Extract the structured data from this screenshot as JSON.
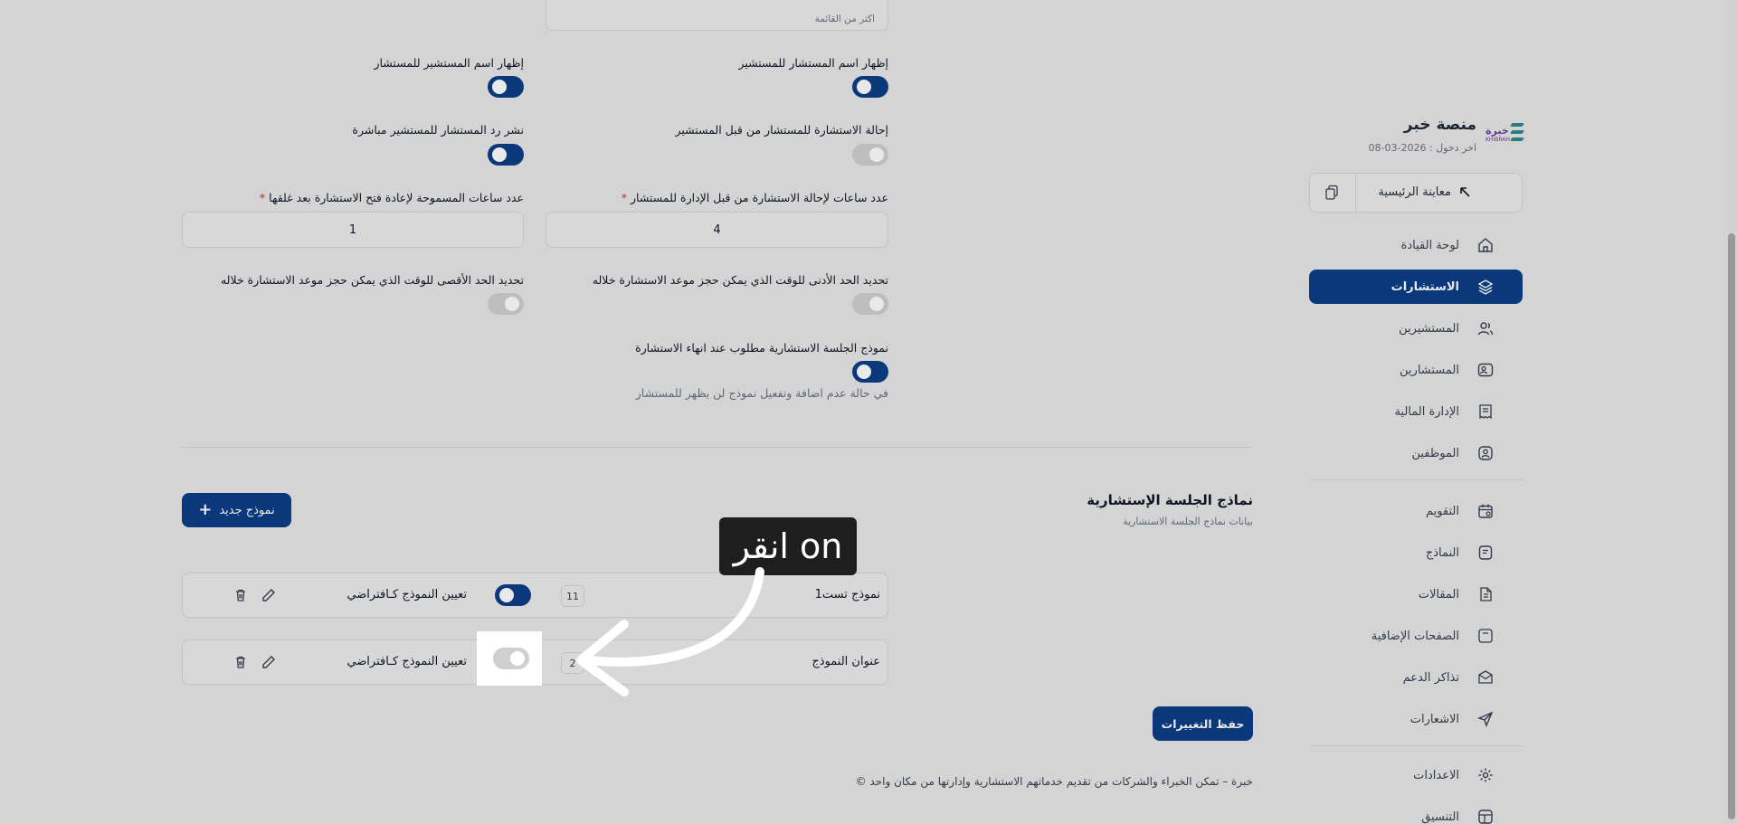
{
  "sidebar": {
    "logo_text": "خبرة",
    "logo_sub": "KHIBRAH",
    "platform_title": "منصة خبر",
    "last_login": "اخر دخول : 2026-03-08",
    "preview_home": "معاينة الرئيسية",
    "items": [
      {
        "label": "لوحة القيادة",
        "icon": "home-icon"
      },
      {
        "label": "الاستشارات",
        "icon": "layers-icon",
        "active": true
      },
      {
        "label": "المستشيرين",
        "icon": "users-icon"
      },
      {
        "label": "المستشارين",
        "icon": "user-card-icon"
      },
      {
        "label": "الإدارة المالية",
        "icon": "receipt-icon"
      },
      {
        "label": "الموظفين",
        "icon": "user-badge-icon"
      },
      {
        "label": "التقويم",
        "icon": "calendar-icon"
      },
      {
        "label": "النماذج",
        "icon": "form-icon"
      },
      {
        "label": "المقالات",
        "icon": "article-icon"
      },
      {
        "label": "الصفحات الإضافية",
        "icon": "pages-icon"
      },
      {
        "label": "تذاكر الدعم",
        "icon": "ticket-icon"
      },
      {
        "label": "الاشعارات",
        "icon": "send-icon"
      },
      {
        "label": "الاعدادات",
        "icon": "gear-icon"
      },
      {
        "label": "التنسيق",
        "icon": "layout-icon"
      }
    ]
  },
  "form": {
    "top_hint": "اكثر من القائمة",
    "show_consultant_name": "إظهار اسم المستشار للمستشير",
    "show_client_name": "إظهار اسم المستشير للمستشار",
    "refer_consultation": "إحالة الاستشارة للمستشار من قبل المستشير",
    "publish_reply": "نشر رد المستشار للمستشير مباشرة",
    "hours_refer": "عدد ساعات لإحالة الاستشارة من قبل الإدارة للمستشار",
    "hours_refer_value": "4",
    "hours_reopen": "عدد ساعات المسموحة لإعادة فتح الاستشارة بعد غلقها",
    "hours_reopen_value": "1",
    "min_time": "تحديد الحد الأدنى للوقت الذي يمكن حجز موعد الاستشارة خلاله",
    "max_time": "تحديد الحد الأقصى للوقت الذي يمكن حجز موعد الاستشارة خلاله",
    "session_form_required": "نموذج الجلسة الاستشارية مطلوب عند انهاء الاستشارة",
    "session_form_hint": "في حالة عدم اضافة وتفعيل نموذج لن يظهر للمستشار",
    "required_mark": "*"
  },
  "models": {
    "title": "نماذج الجلسة الإستشارية",
    "subtitle": "بيانات نماذج الجلسة الاستشارية",
    "new_button": "نموذج جديد",
    "default_label": "تعيين النموذج كـافتراضي",
    "rows": [
      {
        "name": "نموذج تست1",
        "count": "11",
        "default": true
      },
      {
        "name": "عنوان النموذج",
        "count": "2",
        "default": false
      }
    ]
  },
  "save_button": "حفظ التغييرات",
  "footer": "© خبرة – تمكن الخبراء والشركات من تقديم خدماتهم الاستشارية وإدارتها من مكان واحد",
  "annotation": {
    "tooltip": "انقر on"
  },
  "colors": {
    "primary": "#0d3e86",
    "required": "#dc2626",
    "toggle_off": "#cfcfcf"
  }
}
